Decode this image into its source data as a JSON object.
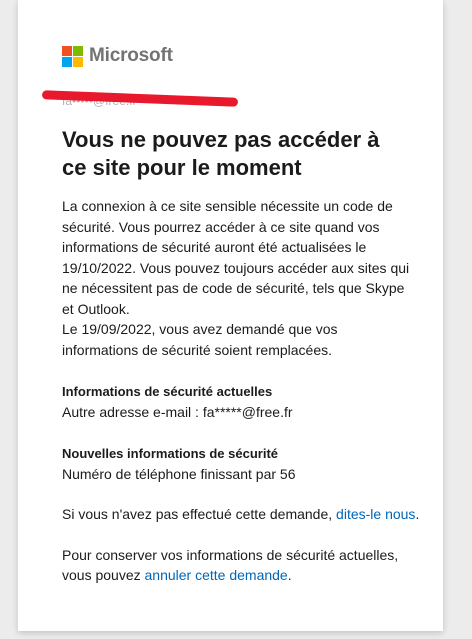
{
  "brand": {
    "name": "Microsoft",
    "colors": {
      "red": "#f25022",
      "green": "#7fba00",
      "blue": "#00a4ef",
      "yellow": "#ffb900"
    }
  },
  "identity": {
    "text": "fa•••••@free.fr",
    "redacted": true,
    "redact_color": "#e8192c"
  },
  "title": "Vous ne pouvez pas accéder à ce site pour le moment",
  "intro": {
    "line1": "La connexion à ce site sensible nécessite un code de sécurité. Vous pourrez accéder à ce site quand vos informations de sécurité auront été actualisées le 19/10/2022. Vous pouvez toujours accéder aux sites qui ne nécessitent pas de code de sécurité, tels que Skype et Outlook.",
    "line2": "Le 19/09/2022, vous avez demandé que vos informations de sécurité soient remplacées."
  },
  "current_info": {
    "title": "Informations de sécurité actuelles",
    "value": "Autre adresse e-mail : fa*****@free.fr"
  },
  "new_info": {
    "title": "Nouvelles informations de sécurité",
    "value": "Numéro de téléphone finissant par 56"
  },
  "not_you": {
    "text": "Si vous n'avez pas effectué cette demande, ",
    "link": "dites-le nous",
    "suffix": "."
  },
  "keep": {
    "text": "Pour conserver vos informations de sécurité actuelles, vous pouvez ",
    "link": "annuler cette demande",
    "suffix": "."
  },
  "link_color": "#0067b8"
}
